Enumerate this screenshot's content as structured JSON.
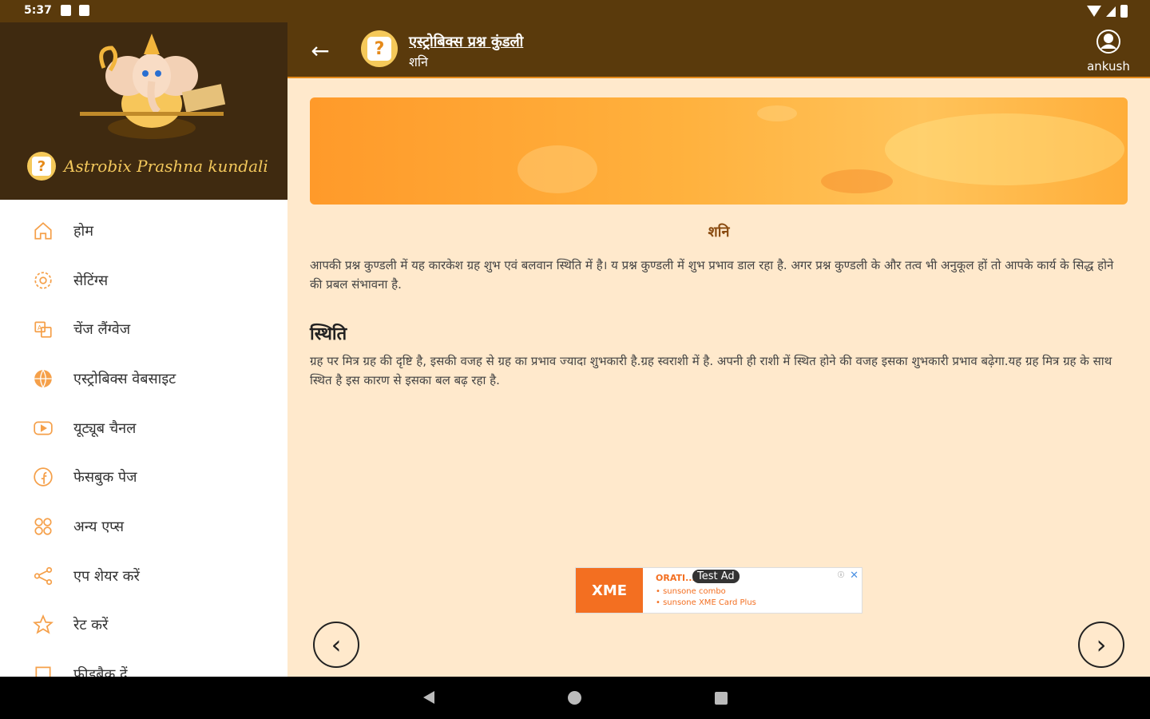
{
  "status_bar": {
    "time": "5:37"
  },
  "drawer": {
    "brand": "Astrobix Prashna kundali",
    "items": [
      {
        "label": "होम",
        "icon": "home-icon"
      },
      {
        "label": "सेटिंग्स",
        "icon": "gear-icon"
      },
      {
        "label": "चेंज लैंग्वेज",
        "icon": "language-icon"
      },
      {
        "label": "एस्ट्रोबिक्स वेबसाइट",
        "icon": "globe-icon"
      },
      {
        "label": "यूट्यूब चैनल",
        "icon": "youtube-icon"
      },
      {
        "label": "फेसबुक पेज",
        "icon": "facebook-icon"
      },
      {
        "label": "अन्य एप्स",
        "icon": "apps-icon"
      },
      {
        "label": "एप शेयर करें",
        "icon": "share-icon"
      },
      {
        "label": "रेट करें",
        "icon": "star-icon"
      },
      {
        "label": "फीडबैक दें",
        "icon": "feedback-icon"
      }
    ]
  },
  "app_bar": {
    "title": "एस्ट्रोबिक्स प्रश्न कुंडली",
    "subtitle": "शनि",
    "user": "ankush"
  },
  "content": {
    "planet": "शनि",
    "para1": "आपकी प्रश्न कुण्डली में यह कारकेश ग्रह शुभ एवं बलवान स्थिति में है। य प्रश्न कुण्डली में शुभ प्रभाव डाल रहा है. अगर प्रश्न कुण्डली के और तत्व भी अनुकूल हों तो आपके कार्य के सिद्ध होने की प्रबल संभावना है.",
    "section_heading": "स्थिति",
    "para2": "ग्रह पर मित्र ग्रह की दृष्टि है, इसकी वजह से ग्रह का प्रभाव ज्यादा शुभकारी है.ग्रह स्वराशी में है. अपनी ही राशी में स्थित होने की वजह इसका शुभकारी प्रभाव बढ़ेगा.यह ग्रह मित्र ग्रह के साथ स्थित है इस कारण से इसका बल बढ़ रहा है."
  },
  "ad": {
    "tag": "Test Ad",
    "logo": "XME",
    "headline": "ORATI... der 35",
    "line1": "• sunsone combo",
    "line2": "• sunsone XME Card Plus"
  },
  "colors": {
    "app_bar": "#5a3a0c",
    "drawer_header": "#3f2a10",
    "content_bg": "#ffe9cc",
    "accent": "#e58a1a",
    "icon_orange": "#f5a04a"
  }
}
